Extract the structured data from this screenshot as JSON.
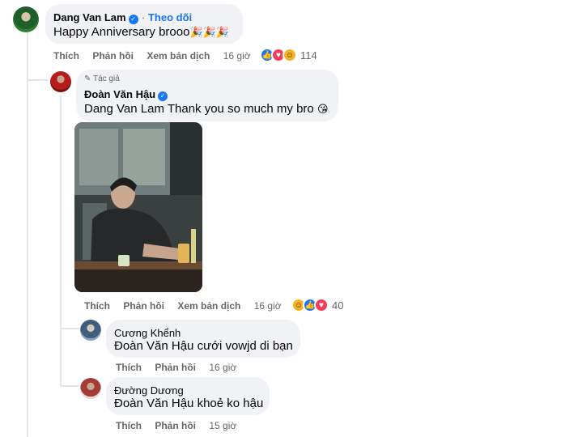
{
  "comments": {
    "main": {
      "author": "Dang Van Lam",
      "follow_label": "Theo dõi",
      "text": "Happy Anniversary brooo",
      "emojis": "🎉🎉🎉",
      "actions": {
        "like": "Thích",
        "reply": "Phản hồi",
        "translate": "Xem bản dịch",
        "time": "16 giờ"
      },
      "reaction_count": "114"
    },
    "reply1": {
      "badge": "Tác giả",
      "author": "Đoàn Văn Hậu",
      "mention": "Dang Van Lam",
      "text": "Thank you so much my bro",
      "emoji": "😘",
      "actions": {
        "like": "Thích",
        "reply": "Phản hồi",
        "translate": "Xem bản dịch",
        "time": "16 giờ"
      },
      "reaction_count": "40"
    },
    "reply2": {
      "author": "Cương Khểnh",
      "mention": "Đoàn Văn Hậu",
      "text": "cưới vowjd di bạn",
      "actions": {
        "like": "Thích",
        "reply": "Phản hồi",
        "time": "16 giờ"
      }
    },
    "reply3": {
      "author": "Đường Dương",
      "mention": "Đoàn Văn Hậu",
      "text": "khoẻ ko hậu",
      "actions": {
        "like": "Thích",
        "reply": "Phản hồi",
        "time": "15 giờ"
      }
    }
  },
  "colors": {
    "bubble": "#f0f2f5",
    "link": "#1877f2",
    "meta": "#65676b"
  }
}
